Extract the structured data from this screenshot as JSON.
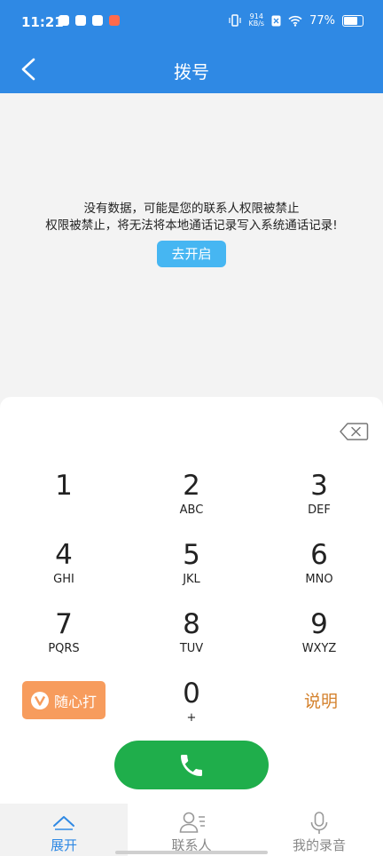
{
  "status_bar": {
    "time": "11:21",
    "net_speed_value": "914",
    "net_speed_unit": "KB/s",
    "battery": "77%"
  },
  "nav": {
    "title": "拨号"
  },
  "empty_state": {
    "line1": "没有数据，可能是您的联系人权限被禁止",
    "line2": "权限被禁止，将无法将本地通话记录写入系统通话记录!",
    "button": "去开启"
  },
  "keypad": {
    "keys": [
      {
        "digit": "1",
        "letters": ""
      },
      {
        "digit": "2",
        "letters": "ABC"
      },
      {
        "digit": "3",
        "letters": "DEF"
      },
      {
        "digit": "4",
        "letters": "GHI"
      },
      {
        "digit": "5",
        "letters": "JKL"
      },
      {
        "digit": "6",
        "letters": "MNO"
      },
      {
        "digit": "7",
        "letters": "PQRS"
      },
      {
        "digit": "8",
        "letters": "TUV"
      },
      {
        "digit": "9",
        "letters": "WXYZ"
      },
      {
        "digit": "0",
        "letters": "+"
      }
    ],
    "random_call_label": "随心打",
    "explain_label": "说明"
  },
  "tabs": [
    {
      "label": "展开",
      "icon": "chevron-up-icon"
    },
    {
      "label": "联系人",
      "icon": "contacts-icon"
    },
    {
      "label": "我的录音",
      "icon": "microphone-icon"
    }
  ],
  "colors": {
    "primary": "#2f89e4",
    "call_green": "#1fae4b",
    "accent_orange": "#f79c5d",
    "open_button": "#46b6f2"
  }
}
